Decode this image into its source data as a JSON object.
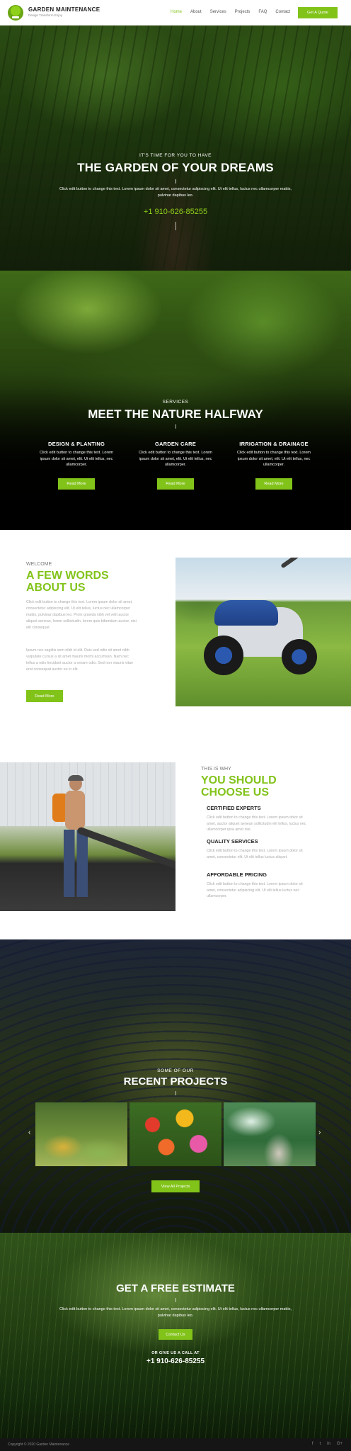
{
  "header": {
    "brand_title": "GARDEN MAINTENANCE",
    "brand_sub": "Design Transform Enjoy",
    "nav": [
      {
        "label": "Home",
        "active": true
      },
      {
        "label": "About",
        "active": false
      },
      {
        "label": "Services",
        "active": false
      },
      {
        "label": "Projects",
        "active": false
      },
      {
        "label": "FAQ",
        "active": false
      },
      {
        "label": "Contact",
        "active": false
      }
    ],
    "cta_label": "Get A Quote"
  },
  "hero": {
    "pretitle": "IT'S TIME FOR YOU TO HAVE",
    "title": "THE GARDEN OF YOUR DREAMS",
    "text": "Click edit button to change this text. Lorem ipsum dolor sit amet, consectetur adipiscing elit. Ut elit tellus, luctus nec ullamcorper mattis, pulvinar dapibus leo.",
    "phone": "+1 910-626-85255"
  },
  "services": {
    "pretitle": "SERVICES",
    "title": "MEET THE NATURE HALFWAY",
    "items": [
      {
        "title": "DESIGN & PLANTING",
        "text": "Click edit button to change this text. Lorem ipsum dolor sit amet, elit. Ut elit tellus, nec ullamcorper.",
        "button": "Read More"
      },
      {
        "title": "GARDEN CARE",
        "text": "Click edit button to change this text. Lorem ipsum dolor sit amet, elit. Ut elit tellus, nec ullamcorper.",
        "button": "Read More"
      },
      {
        "title": "IRRIGATION & DRAINAGE",
        "text": "Click edit button to change this text. Lorem ipsum dolor sit amet, elit. Ut elit tellus, nec ullamcorper.",
        "button": "Read More"
      }
    ]
  },
  "about": {
    "pretitle": "WELCOME",
    "title": "A FEW WORDS ABOUT US",
    "paragraph1": "Click edit button to change this text. Lorem ipsum dolor sit amet, consectetur adipiscing elit. Ut elit tellus, luctus nec ullamcorper mattis, pulvinar dapibus leo. Proin gravida nibh vel velit auctor aliquet aenean, lorem sollicitudin, lorem quis bibendum auctor, nisi elit consequat.",
    "paragraph2": "Ipsum nec sagittis sem nibh id elit. Duis sed odio sit amet nibh vulputate cursus a sit amet mauris morbi accumsan. Nam nec tellus a odio tincidunt auctor a ornare odio. Sed non mauris vitae erat consequat auctor eu in elit.",
    "button": "Read More"
  },
  "why": {
    "pretitle": "THIS IS WHY",
    "title": "YOU SHOULD CHOOSE US",
    "items": [
      {
        "title": "CERTIFIED EXPERTS",
        "text": "Click edit button to change this text. Lorem ipsum dolor sit amet, auctor aliquet aenean sollicitudin elit tellus, luctus nec ullamcorper ipsa amet nisi."
      },
      {
        "title": "QUALITY SERVICES",
        "text": "Click edit button to change this text. Lorem ipsum dolor sit amet, consectetur elit. Ut elit tellus luctus aliquet."
      },
      {
        "title": "AFFORDABLE PRICING",
        "text": "Click edit button to change this text. Lorem ipsum dolor sit amet, consectetur adipiscing elit. Ut elit tellus luctus nec ullamcorper."
      }
    ]
  },
  "projects": {
    "pretitle": "SOME OF OUR",
    "title": "RECENT PROJECTS",
    "prev_glyph": "‹",
    "next_glyph": "›",
    "button": "View All Projects"
  },
  "estimate": {
    "title": "GET A FREE ESTIMATE",
    "text": "Click edit button to change this text. Lorem ipsum dolor sit amet, consectetur adipiscing elit. Ut elit tellus, luctus nec ullamcorper mattis, pulvinar dapibus leo.",
    "button": "Contact Us",
    "call_label": "OR GIVE US A CALL AT",
    "phone": "+1 910-626-85255"
  },
  "footer": {
    "copyright": "Copyright © 2020 Garden Maintenance",
    "socials": [
      {
        "name": "facebook-icon",
        "glyph": "f"
      },
      {
        "name": "twitter-icon",
        "glyph": "t"
      },
      {
        "name": "linkedin-icon",
        "glyph": "in"
      },
      {
        "name": "google-plus-icon",
        "glyph": "G+"
      }
    ]
  },
  "colors": {
    "accent": "#82c31a",
    "footer_bg": "#151515"
  }
}
